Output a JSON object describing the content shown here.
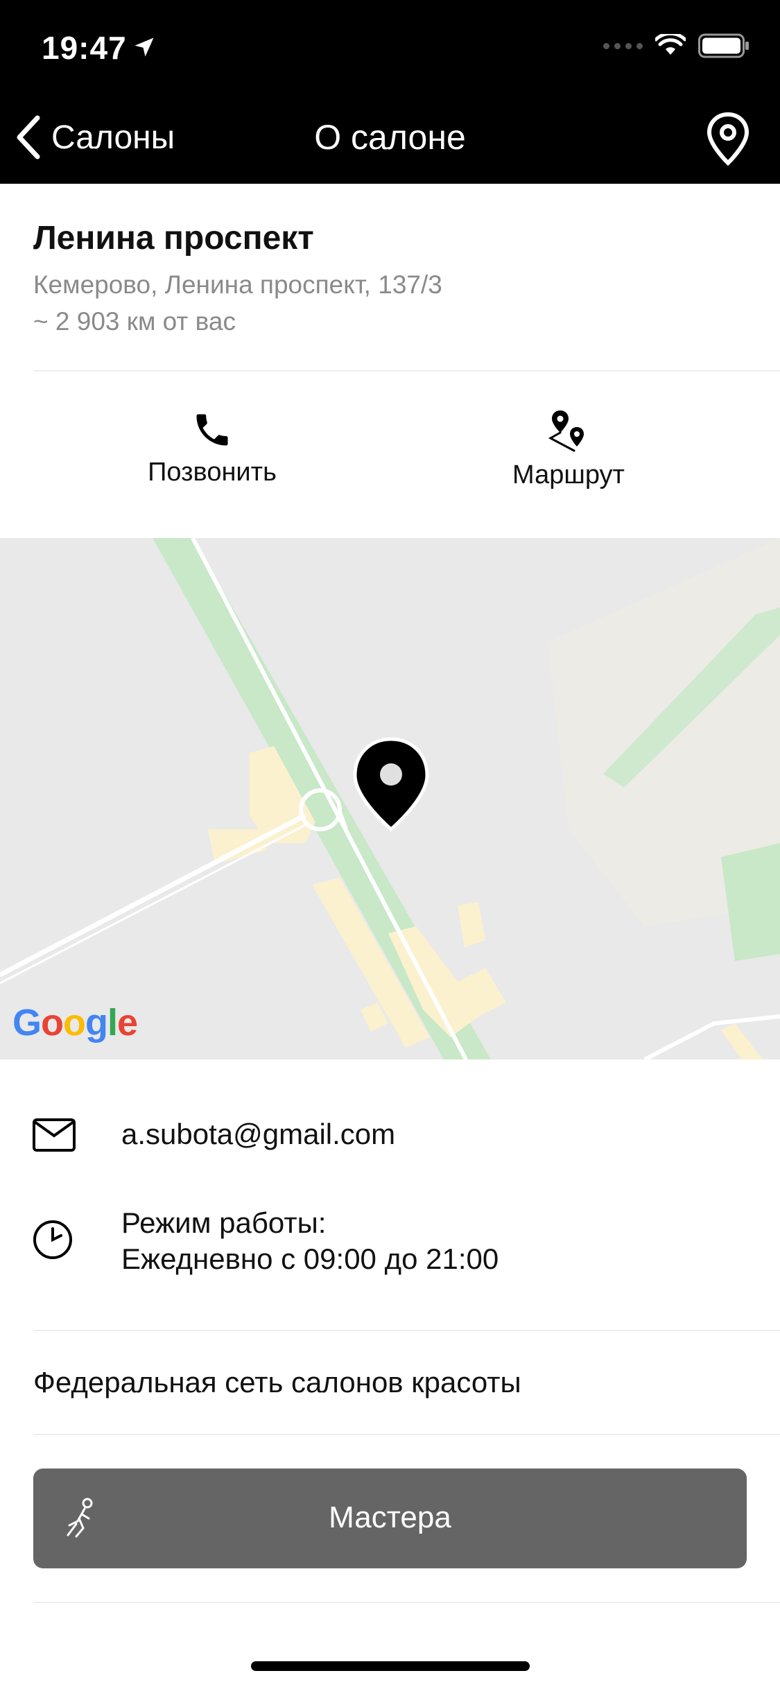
{
  "status_bar": {
    "time": "19:47"
  },
  "nav": {
    "back_label": "Салоны",
    "title": "О салоне"
  },
  "salon": {
    "name": "Ленина проспект",
    "address": "Кемерово, Ленина проспект, 137/3",
    "distance": "~ 2 903 км от вас"
  },
  "actions": {
    "call_label": "Позвонить",
    "route_label": "Маршрут"
  },
  "map": {
    "logo_text": "Google"
  },
  "contact": {
    "email": "a.subota@gmail.com",
    "hours_label": "Режим работы:",
    "hours_value": "Ежедневно с 09:00 до 21:00"
  },
  "description": "Федеральная сеть салонов красоты",
  "masters_button": {
    "label": "Мастера"
  },
  "colors": {
    "bar_background": "#000000",
    "button_background": "#656565",
    "secondary_text": "#8a8a8a",
    "map_background": "#e9e9e9",
    "map_park": "#c6e8c6",
    "map_building": "#fbf1cf"
  }
}
